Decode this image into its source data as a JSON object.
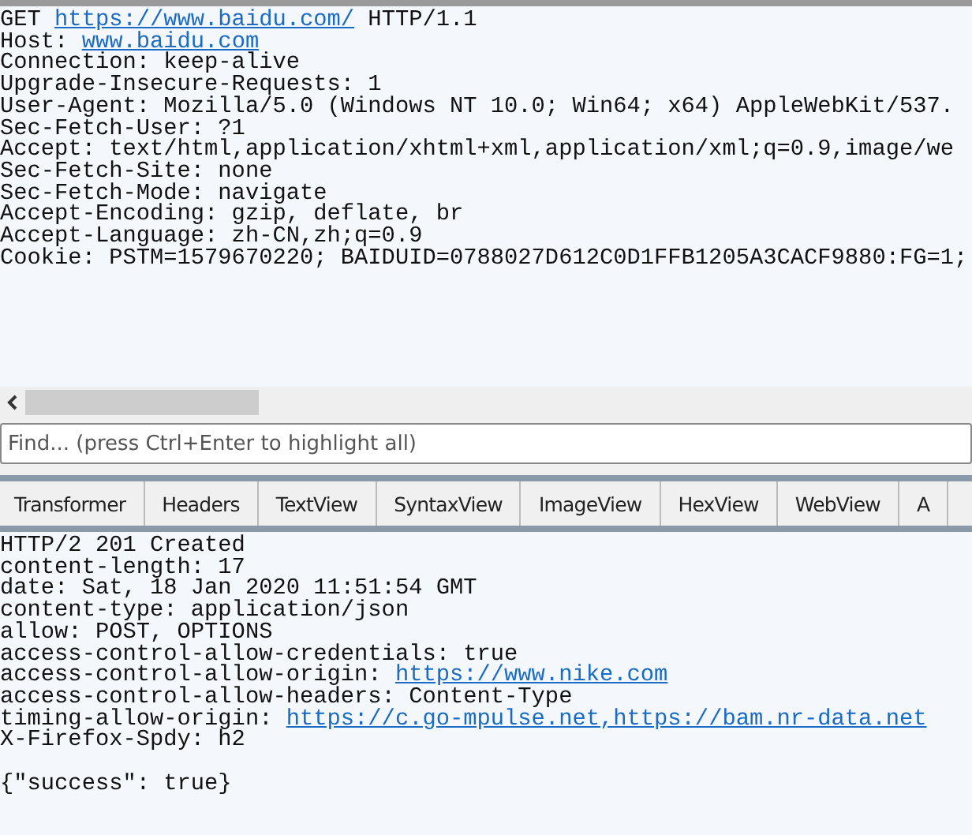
{
  "request": {
    "lines": [
      [
        {
          "kind": "text",
          "text": "GET "
        },
        {
          "kind": "link",
          "text": "https://www.baidu.com/"
        },
        {
          "kind": "text",
          "text": " HTTP/1.1"
        }
      ],
      [
        {
          "kind": "text",
          "text": "Host: "
        },
        {
          "kind": "link",
          "text": "www.baidu.com"
        }
      ],
      [
        {
          "kind": "text",
          "text": "Connection: keep-alive"
        }
      ],
      [
        {
          "kind": "text",
          "text": "Upgrade-Insecure-Requests: 1"
        }
      ],
      [
        {
          "kind": "text",
          "text": "User-Agent: Mozilla/5.0 (Windows NT 10.0; Win64; x64) AppleWebKit/537."
        }
      ],
      [
        {
          "kind": "text",
          "text": "Sec-Fetch-User: ?1"
        }
      ],
      [
        {
          "kind": "text",
          "text": "Accept: text/html,application/xhtml+xml,application/xml;q=0.9,image/we"
        }
      ],
      [
        {
          "kind": "text",
          "text": "Sec-Fetch-Site: none"
        }
      ],
      [
        {
          "kind": "text",
          "text": "Sec-Fetch-Mode: navigate"
        }
      ],
      [
        {
          "kind": "text",
          "text": "Accept-Encoding: gzip, deflate, br"
        }
      ],
      [
        {
          "kind": "text",
          "text": "Accept-Language: zh-CN,zh;q=0.9"
        }
      ],
      [
        {
          "kind": "text",
          "text": "Cookie: PSTM=1579670220; BAIDUID=0788027D612C0D1FFB1205A3CACF9880:FG=1;"
        }
      ]
    ]
  },
  "find": {
    "placeholder": "Find... (press Ctrl+Enter to highlight all)"
  },
  "tabs": [
    {
      "label": "Transformer"
    },
    {
      "label": "Headers"
    },
    {
      "label": "TextView"
    },
    {
      "label": "SyntaxView"
    },
    {
      "label": "ImageView"
    },
    {
      "label": "HexView"
    },
    {
      "label": "WebView"
    },
    {
      "label": "A"
    }
  ],
  "response": {
    "lines": [
      [
        {
          "kind": "text",
          "text": "HTTP/2 201 Created"
        }
      ],
      [
        {
          "kind": "text",
          "text": "content-length: 17"
        }
      ],
      [
        {
          "kind": "text",
          "text": "date: Sat, 18 Jan 2020 11:51:54 GMT"
        }
      ],
      [
        {
          "kind": "text",
          "text": "content-type: application/json"
        }
      ],
      [
        {
          "kind": "text",
          "text": "allow: POST, OPTIONS"
        }
      ],
      [
        {
          "kind": "text",
          "text": "access-control-allow-credentials: true"
        }
      ],
      [
        {
          "kind": "text",
          "text": "access-control-allow-origin: "
        },
        {
          "kind": "link",
          "text": "https://www.nike.com"
        }
      ],
      [
        {
          "kind": "text",
          "text": "access-control-allow-headers: Content-Type"
        }
      ],
      [
        {
          "kind": "text",
          "text": "timing-allow-origin: "
        },
        {
          "kind": "link",
          "text": "https://c.go-mpulse.net,https://bam.nr-data.net"
        }
      ],
      [
        {
          "kind": "text",
          "text": "X-Firefox-Spdy: h2"
        }
      ]
    ],
    "body": [
      [
        {
          "kind": "text",
          "text": "{\"success\": true}"
        }
      ]
    ]
  }
}
